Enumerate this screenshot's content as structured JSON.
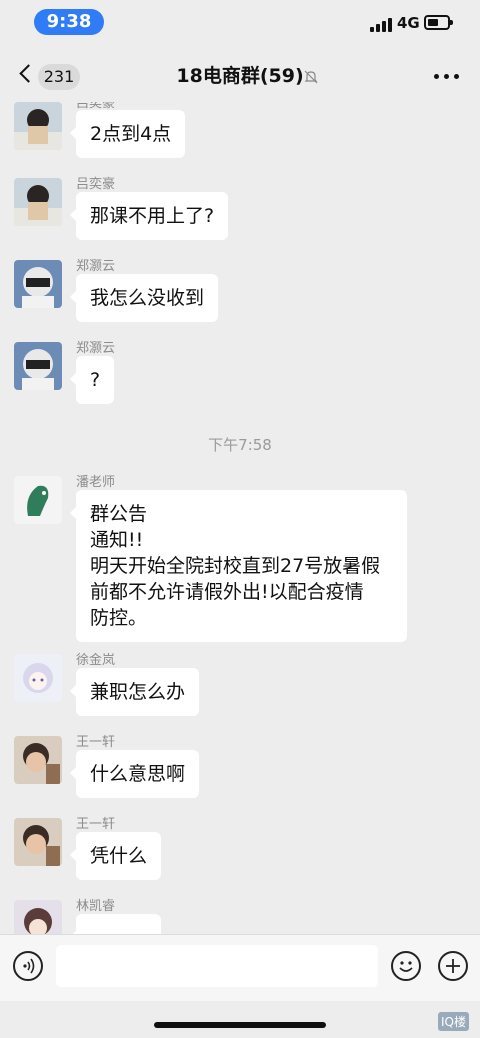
{
  "status_bar": {
    "time": "9:38",
    "network": "4G",
    "battery_level": 0.55
  },
  "nav": {
    "unread_count": "231",
    "title": "18电商群(59)",
    "muted": true
  },
  "messages": [
    {
      "sender": "吕奕豪",
      "text": "2点到4点",
      "avatar": "avatar-photo-boy"
    },
    {
      "sender": "吕奕豪",
      "text": "那课不用上了?",
      "avatar": "avatar-photo-boy"
    },
    {
      "sender": "郑灏云",
      "text": "我怎么没收到",
      "avatar": "avatar-helmet"
    },
    {
      "sender": "郑灏云",
      "text": "?",
      "avatar": "avatar-helmet"
    },
    {
      "sender": "潘老师",
      "lines": [
        "群公告",
        "通知!!",
        "明天开始全院封校直到27号放暑假",
        "前都不允许请假外出!以配合疫情",
        "防控。"
      ],
      "avatar": "avatar-green-horse"
    },
    {
      "sender": "徐金岚",
      "text": "兼职怎么办",
      "avatar": "avatar-anime-girl"
    },
    {
      "sender": "王一轩",
      "text": "什么意思啊",
      "avatar": "avatar-photo-child"
    },
    {
      "sender": "王一轩",
      "text": "凭什么",
      "avatar": "avatar-photo-child"
    },
    {
      "sender": "林凯睿",
      "text": "。。。。。",
      "avatar": "avatar-anime-boy"
    }
  ],
  "time_divider": "下午7:58",
  "input": {
    "placeholder": ""
  },
  "watermark": "IQ楼"
}
